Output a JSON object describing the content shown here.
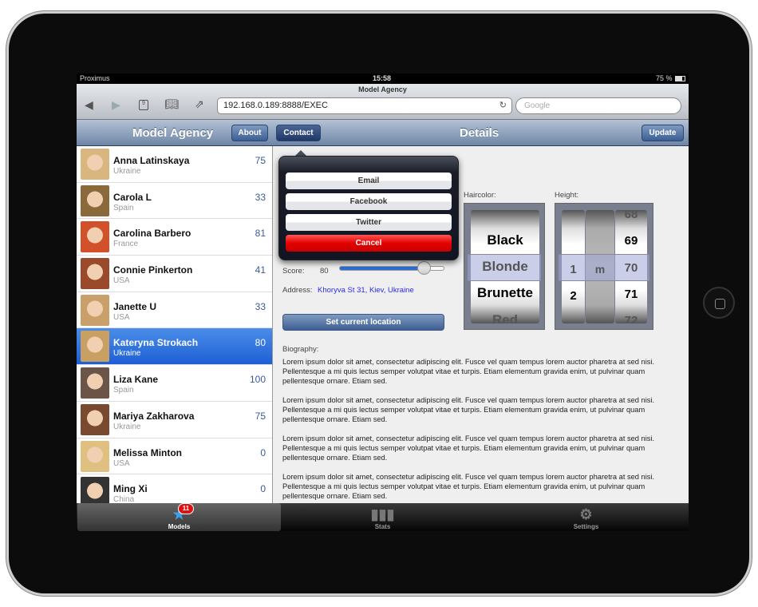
{
  "status": {
    "carrier": "Proximus",
    "time": "15:58",
    "battery": "75 %"
  },
  "browser": {
    "title": "Model Agency",
    "url": "192.168.0.189:8888/EXEC",
    "search_placeholder": "Google",
    "tabs_count": "9"
  },
  "nav": {
    "title": "Model Agency",
    "about": "About",
    "contact": "Contact",
    "details": "Details",
    "update": "Update"
  },
  "models": [
    {
      "name": "Anna Latinskaya",
      "country": "Ukraine",
      "score": "75",
      "color": "#d9b57f"
    },
    {
      "name": "Carola L",
      "country": "Spain",
      "score": "33",
      "color": "#8a6a3a"
    },
    {
      "name": "Carolina Barbero",
      "country": "France",
      "score": "81",
      "color": "#d2502a"
    },
    {
      "name": "Connie Pinkerton",
      "country": "USA",
      "score": "41",
      "color": "#9a4a2a"
    },
    {
      "name": "Janette U",
      "country": "USA",
      "score": "33",
      "color": "#c9a06a"
    },
    {
      "name": "Kateryna Strokach",
      "country": "Ukraine",
      "score": "80",
      "color": "#c8a064",
      "selected": true
    },
    {
      "name": "Liza Kane",
      "country": "Spain",
      "score": "100",
      "color": "#6b5548"
    },
    {
      "name": "Mariya Zakharova",
      "country": "Ukraine",
      "score": "75",
      "color": "#7a4a30"
    },
    {
      "name": "Melissa Minton",
      "country": "USA",
      "score": "0",
      "color": "#e0c080"
    },
    {
      "name": "Ming Xi",
      "country": "China",
      "score": "0",
      "color": "#333333"
    }
  ],
  "popover": {
    "email": "Email",
    "facebook": "Facebook",
    "twitter": "Twitter",
    "cancel": "Cancel"
  },
  "details": {
    "score_label": "Score:",
    "score_value": "80",
    "score_fraction": 0.8,
    "address_label": "Address:",
    "address": "Khoryva St 31, Kiev, Ukraine",
    "set_location": "Set current location",
    "haircolor_label": "Haircolor:",
    "haircolors": [
      "Black",
      "Blonde",
      "Brunette",
      "Red"
    ],
    "haircolor_selected": "Blonde",
    "height_label": "Height:",
    "height_m": [
      "",
      "1",
      "2"
    ],
    "height_unit": "m",
    "height_cm": [
      "68",
      "69",
      "70",
      "71",
      "72"
    ],
    "biography_label": "Biography:",
    "biography": [
      "Lorem ipsum dolor sit amet, consectetur adipiscing elit. Fusce vel quam tempus lorem auctor pharetra at sed nisi. Pellentesque a mi quis lectus semper volutpat vitae et turpis. Etiam elementum gravida enim, ut pulvinar quam pellentesque ornare. Etiam sed.",
      "Lorem ipsum dolor sit amet, consectetur adipiscing elit. Fusce vel quam tempus lorem auctor pharetra at sed nisi. Pellentesque a mi quis lectus semper volutpat vitae et turpis. Etiam elementum gravida enim, ut pulvinar quam pellentesque ornare. Etiam sed.",
      "Lorem ipsum dolor sit amet, consectetur adipiscing elit. Fusce vel quam tempus lorem auctor pharetra at sed nisi. Pellentesque a mi quis lectus semper volutpat vitae et turpis. Etiam elementum gravida enim, ut pulvinar quam pellentesque ornare. Etiam sed.",
      "Lorem ipsum dolor sit amet, consectetur adipiscing elit. Fusce vel quam tempus lorem auctor pharetra at sed nisi. Pellentesque a mi quis lectus semper volutpat vitae et turpis. Etiam elementum gravida enim, ut pulvinar quam pellentesque ornare. Etiam sed."
    ]
  },
  "tabbar": {
    "models": "Models",
    "models_badge": "11",
    "stats": "Stats",
    "settings": "Settings"
  }
}
